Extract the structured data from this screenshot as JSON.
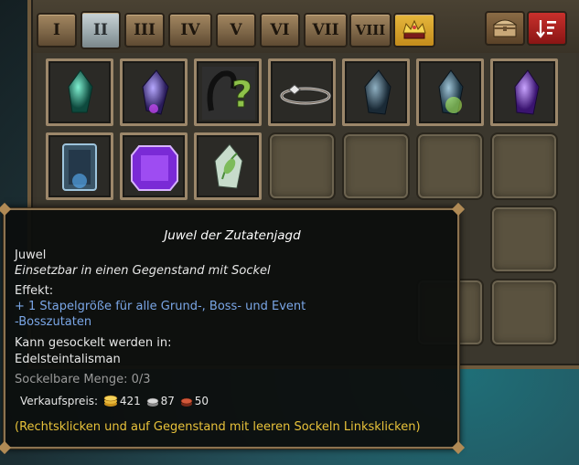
{
  "tabs": [
    {
      "label": "I"
    },
    {
      "label": "II"
    },
    {
      "label": "III"
    },
    {
      "label": "IV"
    },
    {
      "label": "V"
    },
    {
      "label": "VI"
    },
    {
      "label": "VII"
    },
    {
      "label": "VIII"
    }
  ],
  "tab_icons": {
    "crown": "crown-icon",
    "chest": "treasure-chest-icon",
    "sort": "sort-icon"
  },
  "colors": {
    "accent_gold": "#b08a55",
    "tooltip_blue": "#7aa6e6",
    "tooltip_yellow": "#e8c23a",
    "sort_red": "#b32220"
  },
  "slots": [
    {
      "item": "green-gem-icon"
    },
    {
      "item": "purple-gem-icon"
    },
    {
      "item": "mystery-question-icon"
    },
    {
      "item": "silver-ring-icon"
    },
    {
      "item": "dark-gem-icon"
    },
    {
      "item": "glowing-green-gem-icon"
    },
    {
      "item": "violet-gem-icon"
    },
    {
      "item": "blue-square-jewel-icon"
    },
    {
      "item": "amethyst-jewel-icon"
    },
    {
      "item": "leaf-gem-icon"
    }
  ],
  "tooltip": {
    "title": "Juwel der Zutatenjagd",
    "type": "Juwel",
    "subtitle": "Einsetzbar in einen Gegenstand mit Sockel",
    "effect_label": "Effekt:",
    "effect_line1": "+ 1 Stapelgröße für alle Grund-, Boss- und Event",
    "effect_line2": "-Bosszutaten",
    "socket_label": "Kann gesockelt werden in:",
    "socket_target": "Edelsteintalisman",
    "stack": "Sockelbare Menge: 0/3",
    "sell_label": "Verkaufspreis:",
    "gold": "421",
    "silver": "87",
    "copper": "50",
    "hint": "(Rechtsklicken und auf Gegenstand mit leeren Sockeln Linksklicken)"
  }
}
